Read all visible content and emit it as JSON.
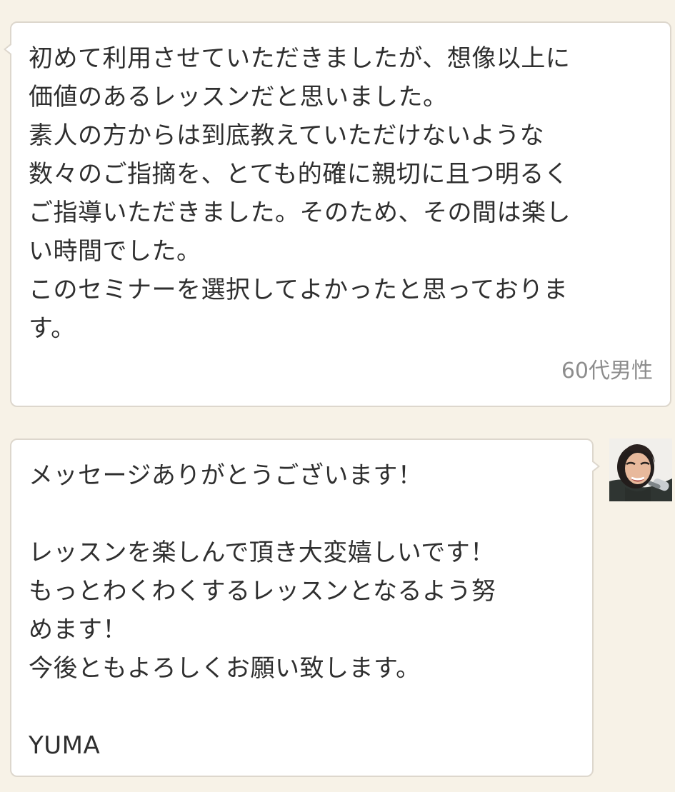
{
  "review": {
    "text": "初めて利用させていただきましたが、想像以上に\n価値のあるレッスンだと思いました。\n素人の方からは到底教えていただけないような\n数々のご指摘を、とても的確に親切に且つ明るく\nご指導いただきました。そのため、その間は楽し\nい時間でした。\nこのセミナーを選択してよかったと思っておりま\nす。",
    "reviewer": "60代男性"
  },
  "reply": {
    "text": "メッセージありがとうございます！\n\nレッスンを楽しんで頂き大変嬉しいです！\nもっとわくわくするレッスンとなるよう努\nめます！\n今後ともよろしくお願い致します。\n\nYUMA",
    "avatar_icon": "instructor-avatar-icon"
  },
  "colors": {
    "background": "#f7f2e7",
    "bubble": "#ffffff",
    "border": "#ddd7cd",
    "text": "#2f2f2f",
    "meta": "#8d8d8d"
  }
}
